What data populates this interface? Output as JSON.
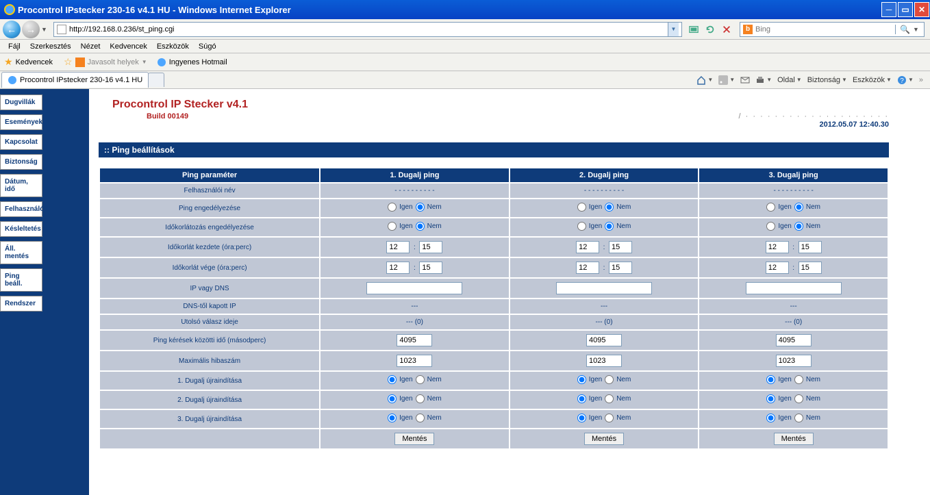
{
  "window": {
    "title": "Procontrol IPstecker 230-16 v4.1 HU - Windows Internet Explorer"
  },
  "address": {
    "url": "http://192.168.0.236/st_ping.cgi"
  },
  "search": {
    "placeholder": "Bing"
  },
  "menu": {
    "file": "Fájl",
    "edit": "Szerkesztés",
    "view": "Nézet",
    "favorites": "Kedvencek",
    "tools": "Eszközök",
    "help": "Súgó"
  },
  "favbar": {
    "fav_label": "Kedvencek",
    "suggested": "Javasolt helyek",
    "hotmail": "Ingyenes Hotmail"
  },
  "tab": {
    "title": "Procontrol IPstecker 230-16 v4.1 HU"
  },
  "cmdbar": {
    "page": "Oldal",
    "safety": "Biztonság",
    "tools": "Eszközök"
  },
  "sidebar": {
    "items": [
      {
        "label": "Dugvillák"
      },
      {
        "label": "Események"
      },
      {
        "label": "Kapcsolat"
      },
      {
        "label": "Biztonság"
      },
      {
        "label": "Dátum, idő"
      },
      {
        "label": "Felhasználó"
      },
      {
        "label": "Késleltetés"
      },
      {
        "label": "Áll. mentés"
      },
      {
        "label": "Ping beáll."
      },
      {
        "label": "Rendszer"
      }
    ]
  },
  "page": {
    "title": "Procontrol IP Stecker v4.1",
    "build": "Build 00149",
    "datetime": "2012.05.07 12:40.30",
    "section": ":: Ping beállítások"
  },
  "table": {
    "headers": [
      "Ping paraméter",
      "1. Dugalj ping",
      "2. Dugalj ping",
      "3. Dugalj ping"
    ],
    "rows": {
      "user": "Felhasználói név",
      "ping_en": "Ping engedélyezése",
      "time_limit_en": "Időkorlátozás engedélyezése",
      "limit_start": "Időkorlát kezdete (óra:perc)",
      "limit_end": "Időkorlát vége (óra:perc)",
      "ip_dns": "IP vagy DNS",
      "dns_ip": "DNS-től kapott IP",
      "last_resp": "Utolsó válasz ideje",
      "ping_interval": "Ping kérések közötti idő (másodperc)",
      "max_err": "Maximális hibaszám",
      "restart1": "1. Dugalj újraindítása",
      "restart2": "2. Dugalj újraindítása",
      "restart3": "3. Dugalj újraindítása"
    },
    "labels": {
      "yes": "Igen",
      "no": "Nem",
      "save": "Mentés",
      "dashes": "- - - - - - - - - -",
      "dash3": "---",
      "dash_zero": "--- (0)"
    },
    "values": {
      "hour": "12",
      "min": "15",
      "interval": "4095",
      "maxerr": "1023",
      "ipdns": ""
    }
  }
}
